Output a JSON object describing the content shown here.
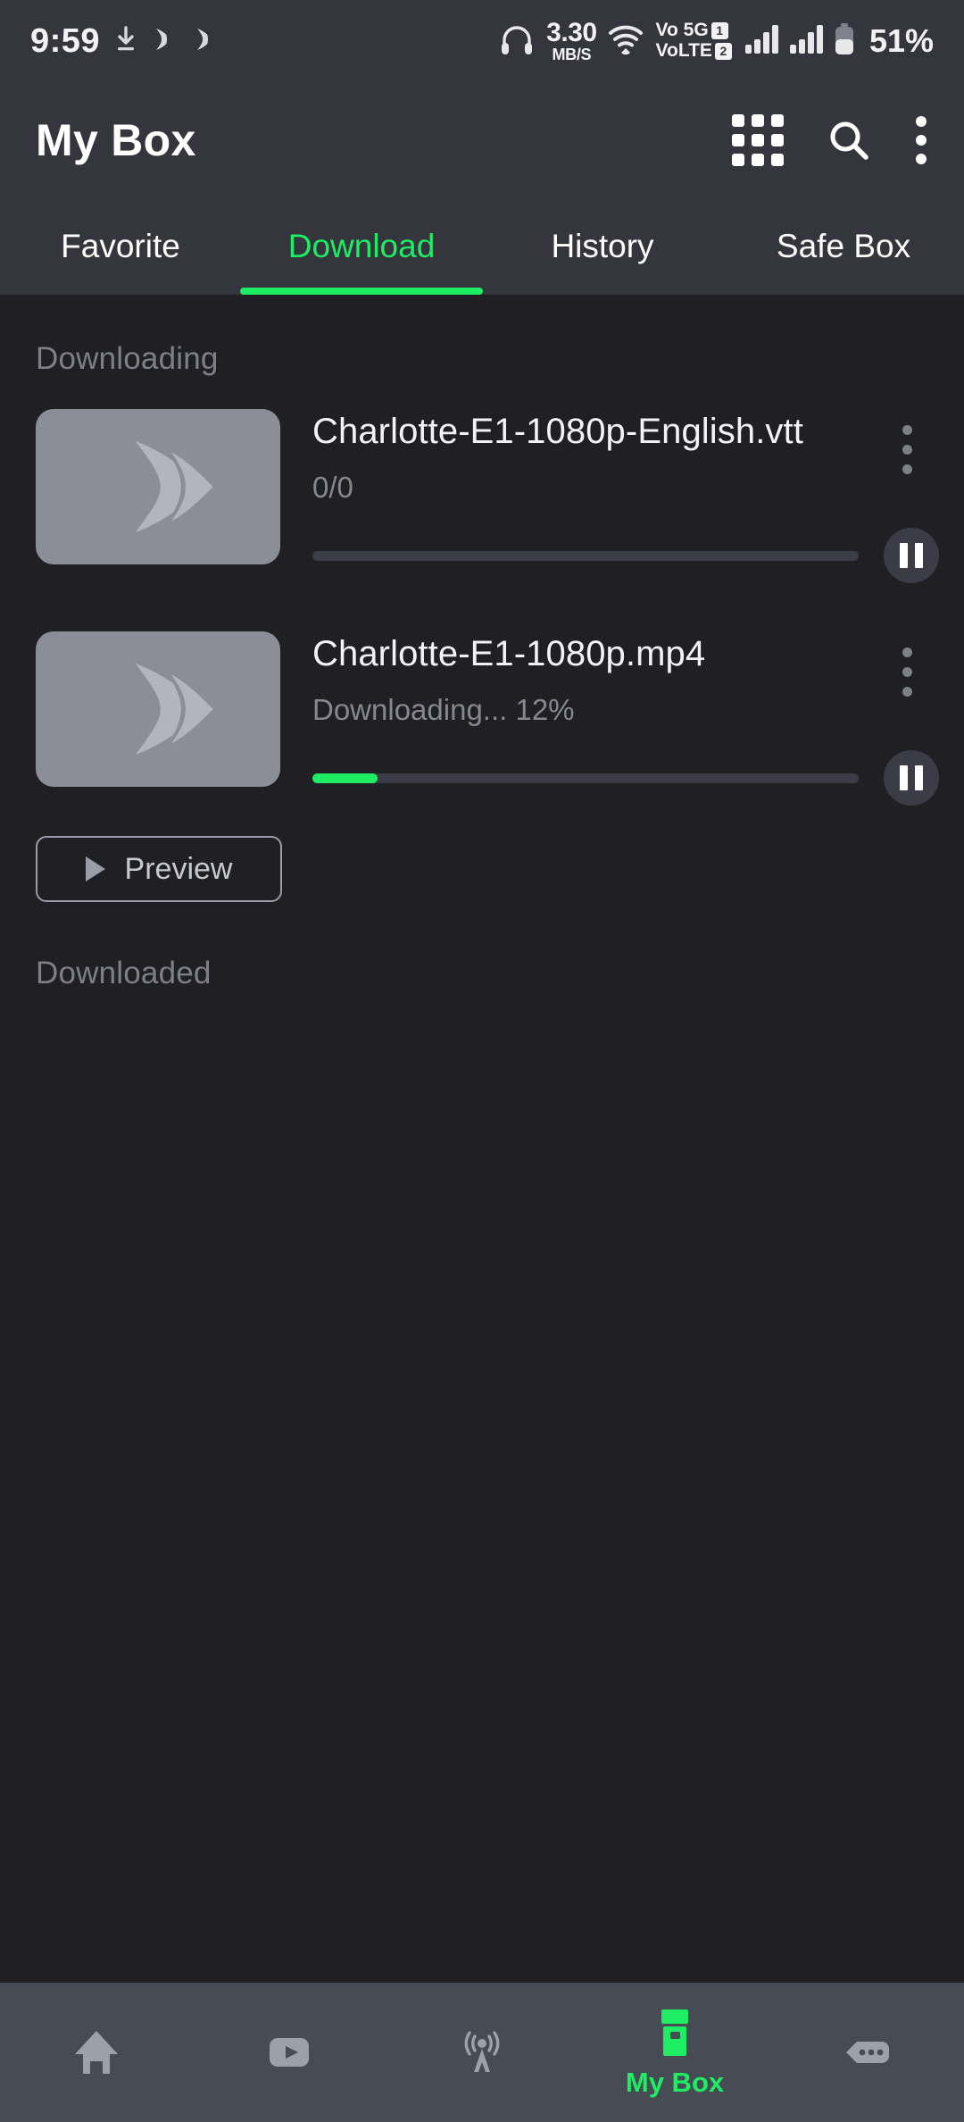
{
  "status_bar": {
    "time": "9:59",
    "left_icons": [
      "download-arrow-icon",
      "app-logo-icon",
      "app-logo-icon"
    ],
    "net_speed_value": "3.30",
    "net_speed_unit": "MB/S",
    "headphone_icon": "headphone-icon",
    "wifi_icon": "wifi-icon",
    "vo_line1": "Vo 5G",
    "vo_line1_sim": "1",
    "vo_line2": "VoLTE",
    "vo_line2_sim": "2",
    "signal_icons": [
      "signal-bars-icon",
      "signal-bars-icon"
    ],
    "battery_icon": "battery-icon",
    "battery_percent": "51%"
  },
  "app_bar": {
    "title": "My Box",
    "actions": [
      {
        "name": "grid-view-icon",
        "label": "Grid view"
      },
      {
        "name": "search-icon",
        "label": "Search"
      },
      {
        "name": "overflow-menu-icon",
        "label": "More options"
      }
    ]
  },
  "tabs": {
    "items": [
      {
        "label": "Favorite",
        "active": false
      },
      {
        "label": "Download",
        "active": true
      },
      {
        "label": "History",
        "active": false
      },
      {
        "label": "Safe Box",
        "active": false
      }
    ]
  },
  "sections": {
    "downloading_label": "Downloading",
    "downloaded_label": "Downloaded"
  },
  "downloads": [
    {
      "title": "Charlotte-E1-1080p-English.vtt",
      "status": "0/0",
      "progress_percent": 0,
      "thumbnail_icon": "video-placeholder-icon",
      "pause_icon": "pause-icon",
      "menu_icon": "overflow-menu-icon"
    },
    {
      "title": "Charlotte-E1-1080p.mp4",
      "status": "Downloading... 12%",
      "progress_percent": 12,
      "thumbnail_icon": "video-placeholder-icon",
      "pause_icon": "pause-icon",
      "menu_icon": "overflow-menu-icon"
    }
  ],
  "preview_button": {
    "label": "Preview",
    "icon": "play-icon"
  },
  "bottom_nav": {
    "items": [
      {
        "label": "",
        "icon": "home-icon",
        "active": false
      },
      {
        "label": "",
        "icon": "video-icon",
        "active": false
      },
      {
        "label": "",
        "icon": "live-broadcast-icon",
        "active": false
      },
      {
        "label": "My Box",
        "icon": "my-box-icon",
        "active": true
      },
      {
        "label": "",
        "icon": "more-ellipsis-icon",
        "active": false
      }
    ]
  },
  "colors": {
    "accent_green": "#1eec63",
    "header_bg": "#35353d",
    "content_bg": "#202024",
    "bottom_nav_bg": "#474b54",
    "muted_text": "#7d8089"
  }
}
